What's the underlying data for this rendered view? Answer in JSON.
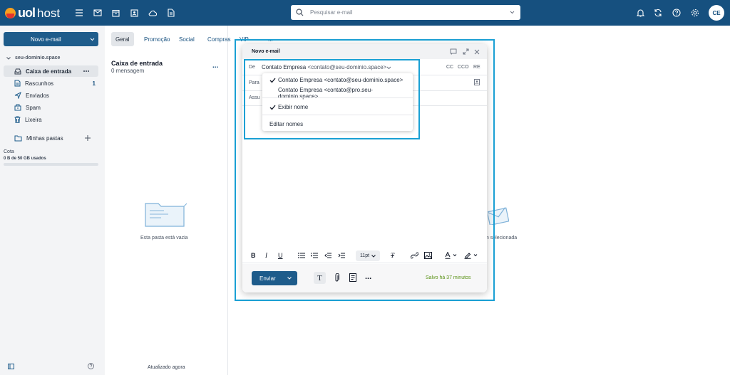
{
  "header": {
    "logo_brand": "uol",
    "logo_product": "host",
    "search_placeholder": "Pesquisar e-mail",
    "avatar_initials": "CE"
  },
  "sidebar": {
    "new_email_label": "Novo e-mail",
    "account": "seu-dominio.space",
    "items": [
      {
        "label": "Caixa de entrada",
        "icon": "inbox-icon",
        "active": true
      },
      {
        "label": "Rascunhos",
        "icon": "draft-icon",
        "count": "1"
      },
      {
        "label": "Enviados",
        "icon": "send-icon"
      },
      {
        "label": "Spam",
        "icon": "spam-icon"
      },
      {
        "label": "Lixeira",
        "icon": "trash-icon"
      }
    ],
    "folders_label": "Minhas pastas",
    "quota_label": "Cota",
    "quota_usage": "0 B de 50 GB usados",
    "quota_fraction": 0
  },
  "list": {
    "tabs": [
      "Geral",
      "Promoção",
      "Social",
      "Compras",
      "VIP",
      "..."
    ],
    "title": "Caixa de entrada",
    "count_text": "0 mensagem",
    "more_label": "...",
    "empty_text": "Esta pasta está vazia",
    "updated_text": "Atualizado agora"
  },
  "reading_pane": {
    "partial_text": "m selecionada"
  },
  "compose": {
    "title": "Novo e-mail",
    "from_label": "De",
    "from_name": "Contato Empresa",
    "from_email": "<contato@seu-dominio.space>",
    "to_label": "Para",
    "subject_label": "Assu",
    "cc_label": "CC",
    "cco_label": "CCO",
    "re_label": "RE",
    "font_size": "11pt",
    "send_label": "Enviar",
    "saved_text": "Salvo há 37 minutos",
    "more_label": "...",
    "dropdown": {
      "options": [
        {
          "label": "Contato Empresa <contato@seu-dominio.space>",
          "checked": true
        },
        {
          "label": "Contato Empresa <contato@pro.seu-dominio.space>",
          "checked": false
        }
      ],
      "show_name_label": "Exibir nome",
      "edit_names_label": "Editar nomes"
    }
  },
  "colors": {
    "topbar": "#16507f",
    "primary": "#1e5c8b",
    "highlight": "#1aa0d4",
    "saved": "#5a9216"
  }
}
